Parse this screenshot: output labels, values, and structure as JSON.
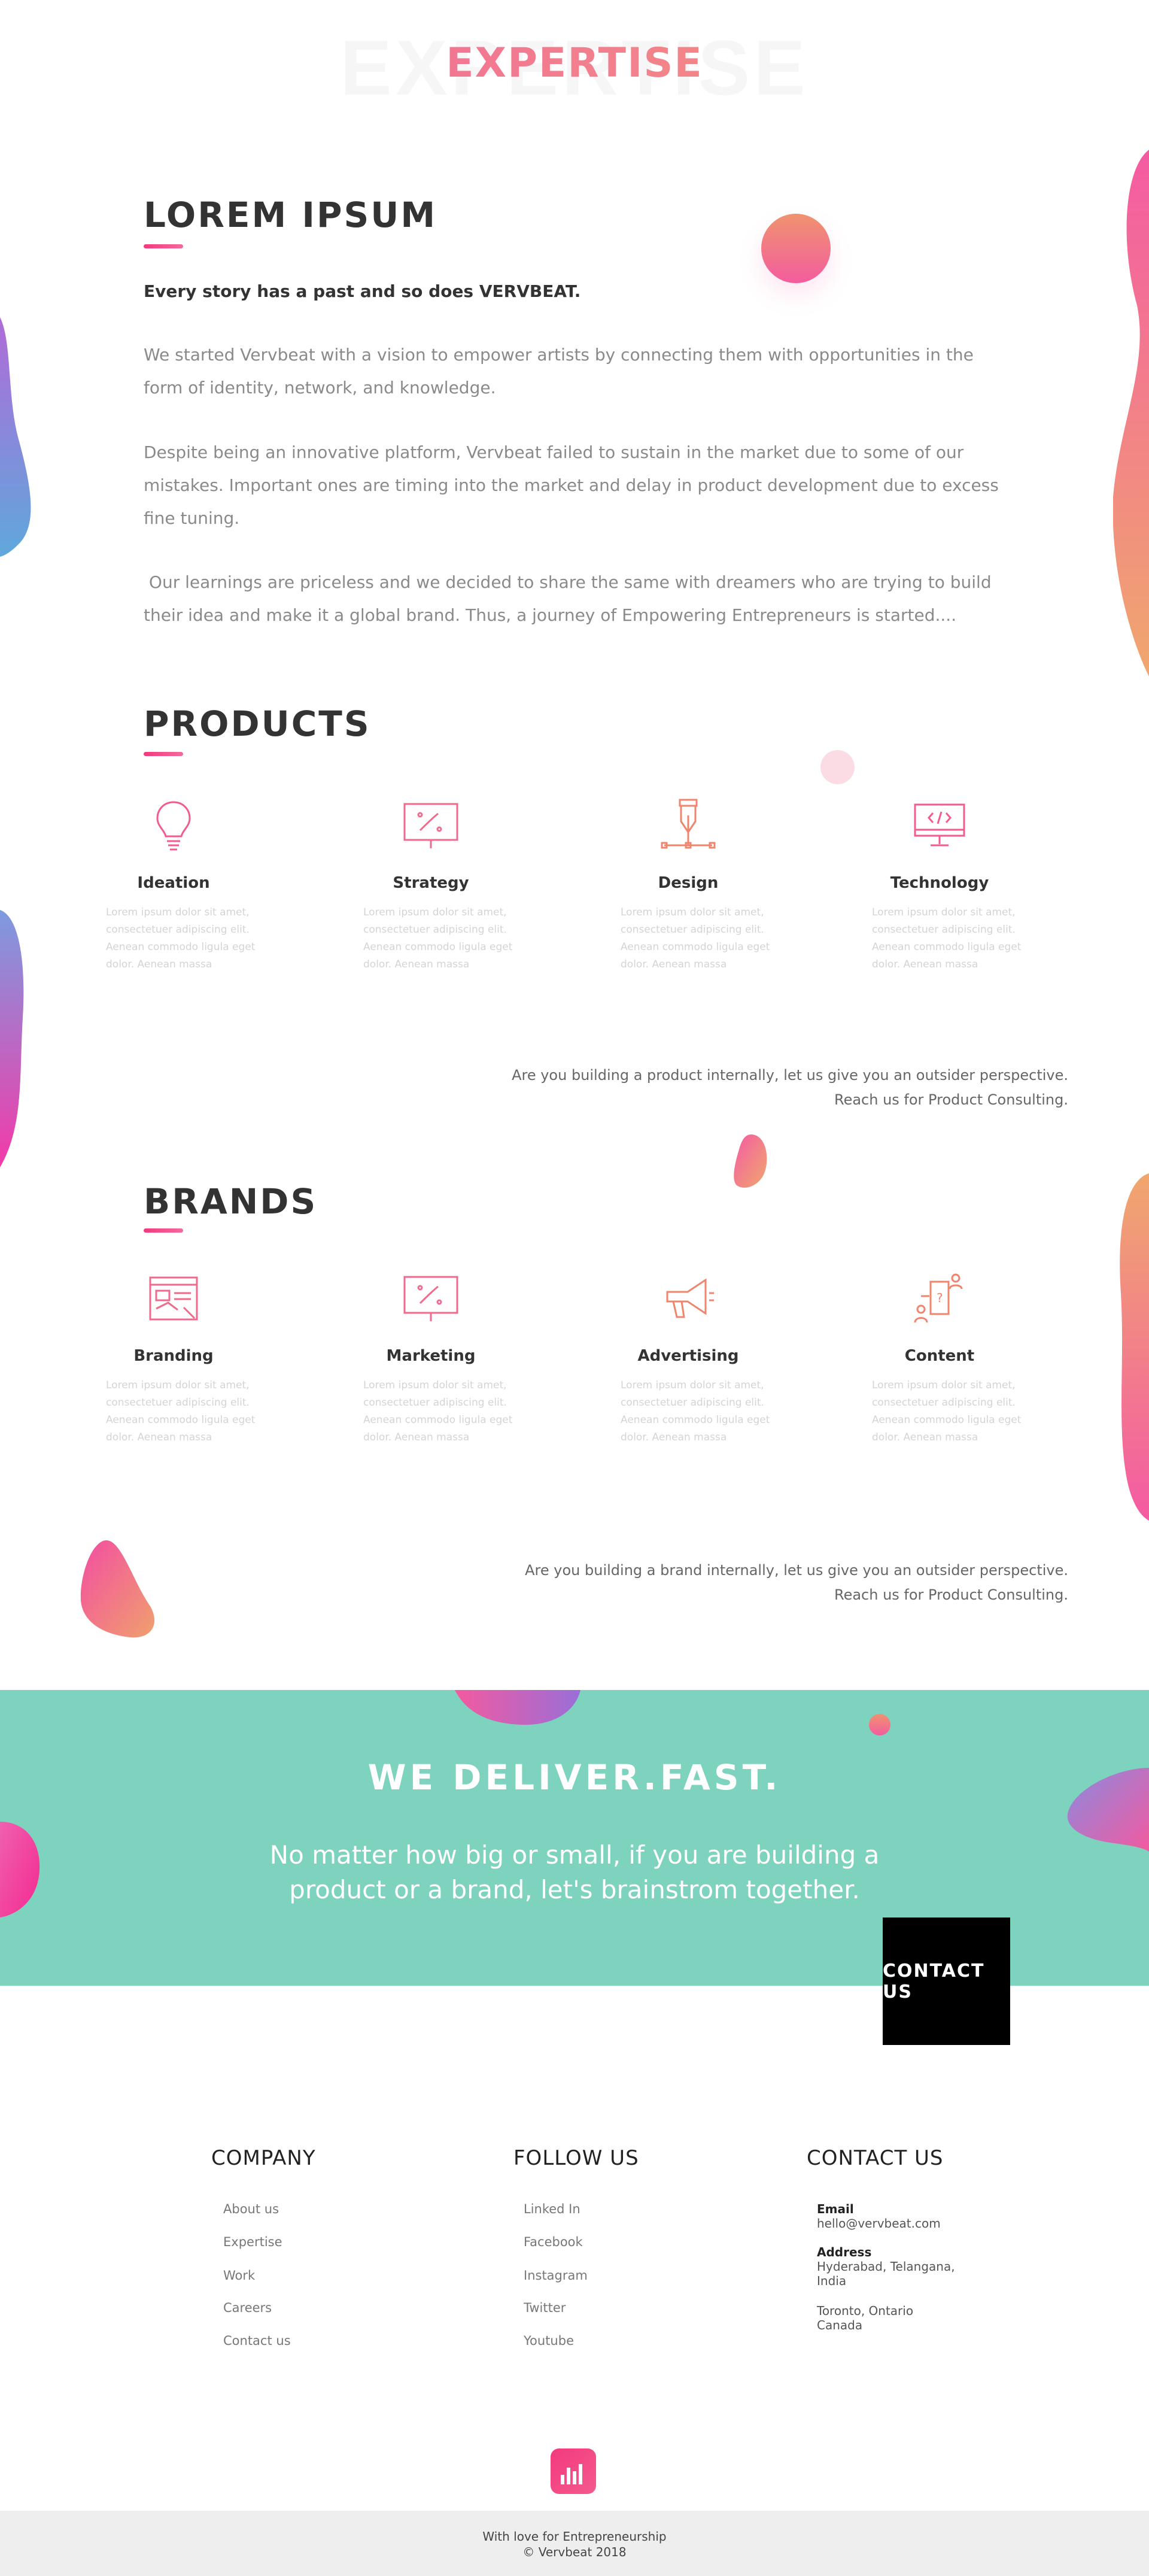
{
  "hero": {
    "bg_text": "EXPERTISE",
    "title": "EXPERTISE"
  },
  "about": {
    "title": "LOREM  IPSUM",
    "lead": "Every story has a past and so does VERVBEAT.",
    "paragraphs": [
      "We started Vervbeat with a vision to empower artists by connecting them with opportunities in the form of identity, network, and knowledge.",
      "Despite being an innovative platform, Vervbeat failed to sustain in the market due to some of our mistakes. Important ones are timing into the market and delay in product development due to excess fine tuning.",
      " Our learnings are priceless and we decided to share the same with dreamers who are trying to build their idea and make it a global brand. Thus, a journey of Empowering Entrepreneurs is started...."
    ]
  },
  "products": {
    "title": "PRODUCTS",
    "items": [
      {
        "title": "Ideation",
        "icon": "lightbulb-icon",
        "desc": "Lorem ipsum dolor sit amet, consectetuer adipiscing elit. Aenean commodo ligula eget dolor. Aenean massa"
      },
      {
        "title": "Strategy",
        "icon": "strategy-board-icon",
        "desc": "Lorem ipsum dolor sit amet, consectetuer adipiscing elit. Aenean commodo ligula eget dolor. Aenean massa"
      },
      {
        "title": "Design",
        "icon": "pen-tool-icon",
        "desc": "Lorem ipsum dolor sit amet, consectetuer adipiscing elit. Aenean commodo ligula eget dolor. Aenean massa"
      },
      {
        "title": "Technology",
        "icon": "code-monitor-icon",
        "desc": "Lorem ipsum dolor sit amet, consectetuer adipiscing elit. Aenean commodo ligula eget dolor. Aenean massa"
      }
    ],
    "note_line1": "Are you building a product internally, let us give you an outsider perspective.",
    "note_line2": "Reach us for Product Consulting."
  },
  "brands": {
    "title": "BRANDS",
    "items": [
      {
        "title": "Branding",
        "icon": "branding-icon",
        "desc": "Lorem ipsum dolor sit amet, consectetuer adipiscing elit. Aenean commodo ligula eget dolor. Aenean massa"
      },
      {
        "title": "Marketing",
        "icon": "marketing-board-icon",
        "desc": "Lorem ipsum dolor sit amet, consectetuer adipiscing elit. Aenean commodo ligula eget dolor. Aenean massa"
      },
      {
        "title": "Advertising",
        "icon": "megaphone-icon",
        "desc": "Lorem ipsum dolor sit amet, consectetuer adipiscing elit. Aenean commodo ligula eget dolor. Aenean massa"
      },
      {
        "title": "Content",
        "icon": "content-flow-icon",
        "desc": "Lorem ipsum dolor sit amet, consectetuer adipiscing elit. Aenean commodo ligula eget dolor. Aenean massa"
      }
    ],
    "note_line1": "Are you building a brand internally, let us give you an outsider perspective.",
    "note_line2": "Reach us for Product Consulting."
  },
  "band": {
    "title": "WE DELIVER.FAST.",
    "text_line1": "No matter how big or small, if you are building a",
    "text_line2": "product or a brand, let's brainstrom together.",
    "button": "CONTACT US"
  },
  "footer": {
    "company": {
      "title": "COMPANY",
      "links": [
        "About us",
        "Expertise",
        "Work",
        "Careers",
        "Contact us"
      ]
    },
    "follow": {
      "title": "FOLLOW US",
      "links": [
        "Linked In",
        "Facebook",
        "Instagram",
        "Twitter",
        "Youtube"
      ]
    },
    "contact": {
      "title": "CONTACT US",
      "email_label": "Email",
      "email": "hello@vervbeat.com",
      "address_label": "Address",
      "address1_line1": "Hyderabad, Telangana,",
      "address1_line2": "India",
      "address2_line1": "Toronto, Ontario",
      "address2_line2": "Canada"
    },
    "tagline": "With love for Entrepreneurship",
    "copyright": "© Vervbeat  2018"
  },
  "colors": {
    "accent": "#f3397d",
    "teal": "#7dd3bd",
    "gradient_start": "#f45ba3",
    "gradient_end": "#f0a178"
  }
}
